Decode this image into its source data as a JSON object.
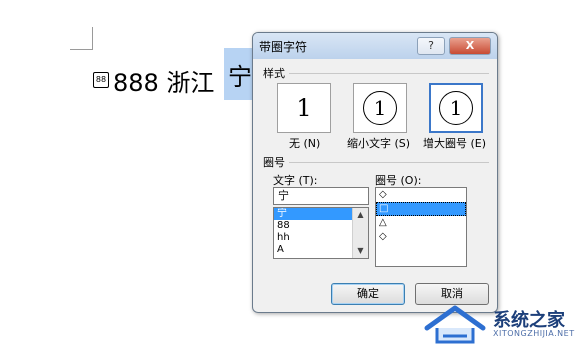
{
  "document": {
    "small_circled_char": "88",
    "text": "888 浙江",
    "selected_char": "宁"
  },
  "dialog": {
    "title": "带圈字符",
    "help_button": "?",
    "close_button": "X",
    "style_section": {
      "label": "样式",
      "options": [
        {
          "caption": "无 (N)",
          "glyph": "1",
          "circled": false
        },
        {
          "caption": "缩小文字 (S)",
          "glyph": "1",
          "circled": true
        },
        {
          "caption": "增大圈号 (E)",
          "glyph": "1",
          "circled": true,
          "selected": true
        }
      ]
    },
    "enclosure_section": {
      "label": "圈号",
      "text_label": "文字 (T):",
      "text_value": "宁",
      "text_list": [
        "宁",
        "88",
        "hh",
        "A"
      ],
      "text_list_selected_index": 0,
      "enclosure_label": "圈号 (O):",
      "enclosure_list": [
        "◇",
        "□",
        "△",
        "◇"
      ],
      "enclosure_list_selected_index": 1
    },
    "ok_label": "确定",
    "cancel_label": "取消"
  },
  "watermark": {
    "title": "系统之家",
    "subtitle": "XITONGZHIJIA.NET"
  }
}
